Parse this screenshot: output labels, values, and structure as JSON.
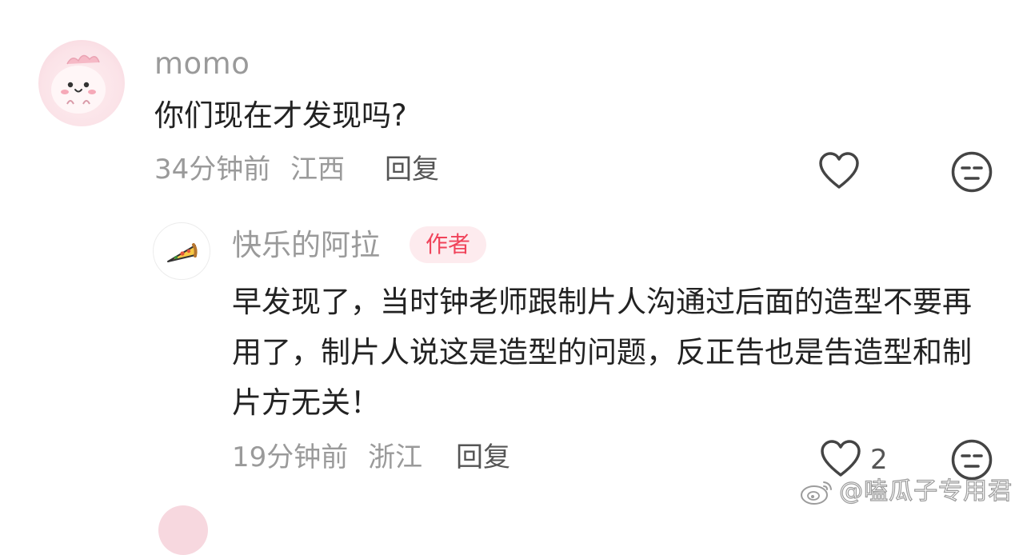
{
  "comments": {
    "main": {
      "username": "momo",
      "content": "你们现在才发现吗?",
      "time": "34分钟前",
      "location": "江西",
      "reply_label": "回复",
      "avatar_icon": "pink-dino-avatar-icon"
    },
    "reply": {
      "username": "快乐的阿拉",
      "badge": "作者",
      "content": "早发现了，当时钟老师跟制片人沟通过后面的造型不要再用了，制片人说这是造型的问题，反正告也是告造型和制片方无关！",
      "time": "19分钟前",
      "location": "浙江",
      "reply_label": "回复",
      "like_count": "2",
      "avatar_icon": "pizza-avatar-icon"
    }
  },
  "watermark": {
    "text": "@嗑瓜子专用君",
    "logo_icon": "weibo-logo-icon"
  },
  "colors": {
    "text_primary": "#222222",
    "text_secondary": "#9a9a9a",
    "badge_bg": "#fdebee",
    "badge_text": "#f0435a",
    "icon_stroke": "#444444"
  }
}
